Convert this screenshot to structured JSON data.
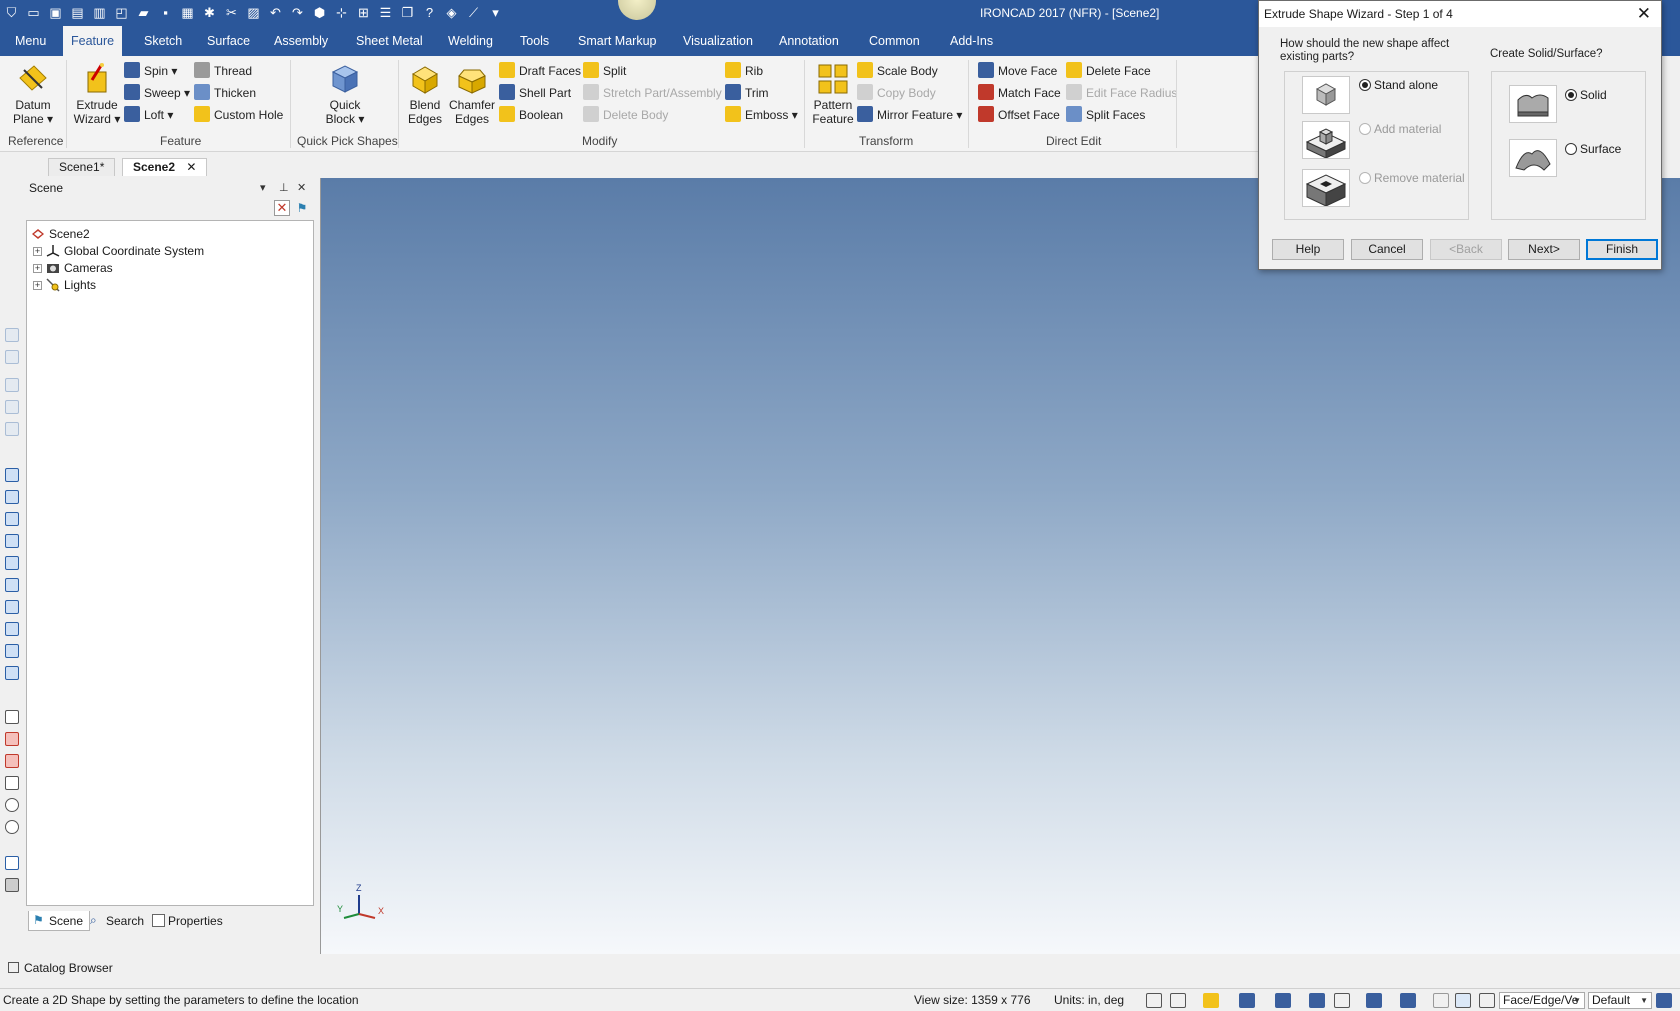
{
  "window": {
    "title": "IRONCAD 2017 (NFR) - [Scene2]"
  },
  "ribbon_tabs": [
    "Menu",
    "Feature",
    "Sketch",
    "Surface",
    "Assembly",
    "Sheet Metal",
    "Welding",
    "Tools",
    "Smart Markup",
    "Visualization",
    "Annotation",
    "Common",
    "Add-Ins"
  ],
  "active_ribbon_tab": "Feature",
  "ribbon": {
    "reference": {
      "label": "Reference",
      "datum_plane_1": "Datum",
      "datum_plane_2": "Plane"
    },
    "feature": {
      "label": "Feature",
      "extrude_1": "Extrude",
      "extrude_2": "Wizard",
      "spin": "Spin",
      "sweep": "Sweep",
      "loft": "Loft",
      "thread": "Thread",
      "thicken": "Thicken",
      "custom_hole": "Custom Hole"
    },
    "quick_pick": {
      "label": "Quick Pick Shapes",
      "quick_1": "Quick",
      "quick_2": "Block"
    },
    "modify": {
      "label": "Modify",
      "blend_1": "Blend",
      "blend_2": "Edges",
      "chamfer_1": "Chamfer",
      "chamfer_2": "Edges",
      "draft_faces": "Draft Faces",
      "shell_part": "Shell Part",
      "boolean": "Boolean",
      "split": "Split",
      "stretch": "Stretch Part/Assembly",
      "delete_body": "Delete Body",
      "rib": "Rib",
      "trim": "Trim",
      "emboss": "Emboss"
    },
    "transform": {
      "label": "Transform",
      "pattern_1": "Pattern",
      "pattern_2": "Feature",
      "scale_body": "Scale Body",
      "copy_body": "Copy Body",
      "mirror_feature": "Mirror Feature"
    },
    "direct_edit": {
      "label": "Direct Edit",
      "move_face": "Move Face",
      "match_face": "Match Face",
      "offset_face": "Offset Face",
      "delete_face": "Delete Face",
      "edit_face_radius": "Edit Face Radius",
      "split_faces": "Split Faces"
    }
  },
  "document_tabs": [
    "Scene1*",
    "Scene2"
  ],
  "active_document": "Scene2",
  "scene_panel": {
    "title": "Scene",
    "tree": [
      {
        "label": "Scene2",
        "expandable": false
      },
      {
        "label": "Global Coordinate System",
        "expandable": true
      },
      {
        "label": "Cameras",
        "expandable": true
      },
      {
        "label": "Lights",
        "expandable": true
      }
    ],
    "bottom_tabs": [
      "Scene",
      "Search",
      "Properties"
    ]
  },
  "catalog_browser": "Catalog Browser",
  "triad": {
    "z": "Z",
    "y": "Y",
    "x": "X"
  },
  "status": {
    "message": "Create a 2D Shape by setting the parameters to define the location",
    "view_size": "View size: 1359 x  776",
    "units": "Units: in, deg",
    "selection_filter": "Face/Edge/Ve",
    "style": "Default"
  },
  "dialog": {
    "title": "Extrude Shape Wizard - Step 1 of 4",
    "question_left": "How should the new shape affect existing parts?",
    "question_right": "Create Solid/Surface?",
    "options_left": [
      {
        "label": "Stand alone",
        "selected": true,
        "enabled": true
      },
      {
        "label": "Add material",
        "selected": false,
        "enabled": false
      },
      {
        "label": "Remove material",
        "selected": false,
        "enabled": false
      }
    ],
    "options_right": [
      {
        "label": "Solid",
        "selected": true
      },
      {
        "label": "Surface",
        "selected": false
      }
    ],
    "buttons": {
      "help": "Help",
      "cancel": "Cancel",
      "back": "<Back",
      "next": "Next>",
      "finish": "Finish"
    }
  },
  "colors": {
    "accent": "#2b579a",
    "viewport_top": "#5a7ca8",
    "viewport_bottom": "#f6f8fb",
    "icon_yellow": "#f2c21b"
  }
}
